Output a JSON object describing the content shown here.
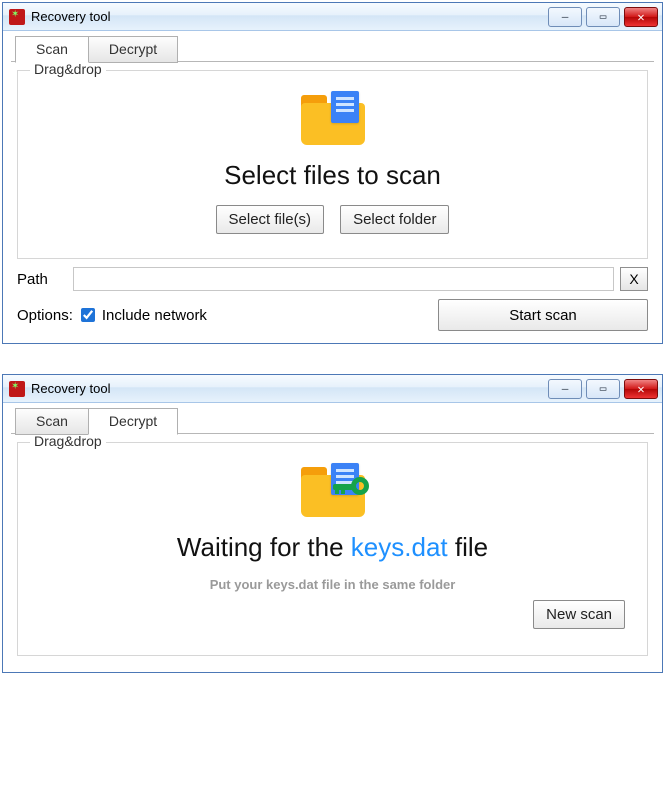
{
  "window1": {
    "title": "Recovery tool",
    "tabs": {
      "scan": "Scan",
      "decrypt": "Decrypt"
    },
    "fieldset_legend": "Drag&drop",
    "heading": "Select files to scan",
    "buttons": {
      "select_files": "Select file(s)",
      "select_folder": "Select folder"
    },
    "path_label": "Path",
    "path_value": "",
    "clear_btn": "X",
    "options_label": "Options:",
    "include_network_label": "Include network",
    "include_network_checked": true,
    "start_scan": "Start scan"
  },
  "window2": {
    "title": "Recovery tool",
    "tabs": {
      "scan": "Scan",
      "decrypt": "Decrypt"
    },
    "fieldset_legend": "Drag&drop",
    "heading_prefix": "Waiting for the ",
    "heading_keyfile": "keys.dat",
    "heading_suffix": " file",
    "subtext": "Put your keys.dat file in the same folder",
    "new_scan": "New scan"
  }
}
